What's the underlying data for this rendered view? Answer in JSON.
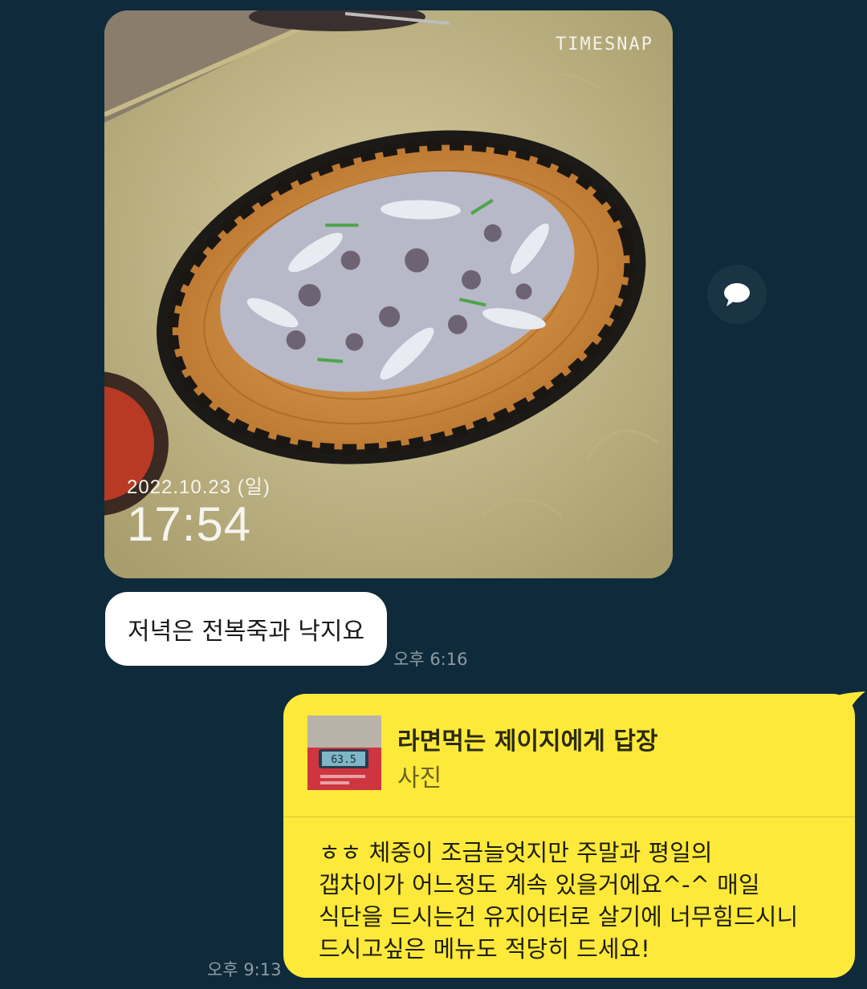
{
  "photo_message": {
    "watermark": "TIMESNAP",
    "date_stamp": "2022.10.23 (일)",
    "time_stamp": "17:54"
  },
  "share_button_icon": "chat-bubble-icon",
  "incoming_text": {
    "text": "저녁은 전복죽과 낙지요",
    "time": "오후 6:16"
  },
  "outgoing_reply": {
    "reply_title": "라면먹는 제이지에게 답장",
    "reply_subtitle": "사진",
    "thumb_display": "63.5",
    "lines": [
      "ㅎㅎ 체중이 조금늘엇지만 주말과 평일의",
      "갭차이가 어느정도 계속 있을거에요^-^ 매일",
      "식단을 드시는건 유지어터로 살기에 너무힘드시니",
      "드시고싶은 메뉴도 적당히 드세요!"
    ],
    "time": "오후 9:13"
  },
  "colors": {
    "background": "#0f2a3a",
    "outgoing_bubble": "#fde93a",
    "incoming_bubble": "#ffffff"
  }
}
